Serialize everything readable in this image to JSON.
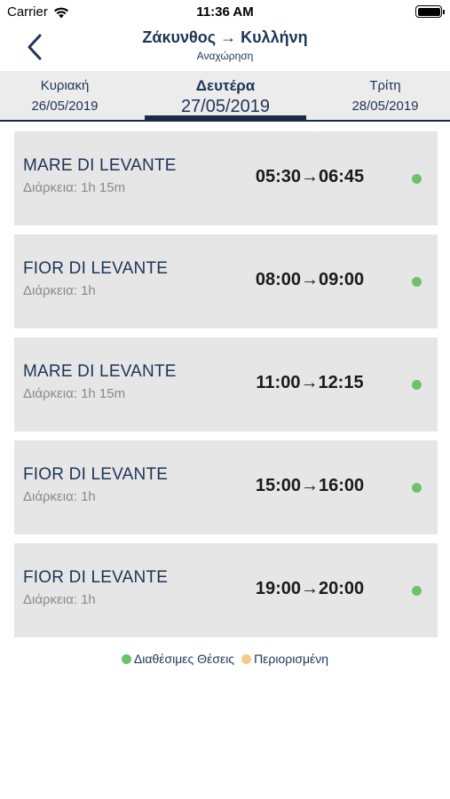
{
  "status_bar": {
    "carrier": "Carrier",
    "time": "11:36 AM"
  },
  "nav": {
    "title": "Ζάκυνθος → Κυλλήνη",
    "subtitle": "Αναχώρηση"
  },
  "dates": {
    "prev": {
      "day": "Κυριακή",
      "date": "26/05/2019"
    },
    "current": {
      "day": "Δευτέρα",
      "date": "27/05/2019"
    },
    "next": {
      "day": "Τρίτη",
      "date": "28/05/2019"
    }
  },
  "trips": [
    {
      "ship": "MARE DI LEVANTE",
      "duration": "Διάρκεια: 1h 15m",
      "time": "05:30→06:45",
      "status_color": "#6cc36a"
    },
    {
      "ship": "FIOR DI LEVANTE",
      "duration": "Διάρκεια: 1h",
      "time": "08:00→09:00",
      "status_color": "#6cc36a"
    },
    {
      "ship": "MARE DI LEVANTE",
      "duration": "Διάρκεια: 1h 15m",
      "time": "11:00→12:15",
      "status_color": "#6cc36a"
    },
    {
      "ship": "FIOR DI LEVANTE",
      "duration": "Διάρκεια: 1h",
      "time": "15:00→16:00",
      "status_color": "#6cc36a"
    },
    {
      "ship": "FIOR DI LEVANTE",
      "duration": "Διάρκεια: 1h",
      "time": "19:00→20:00",
      "status_color": "#6cc36a"
    }
  ],
  "legend": {
    "available": {
      "label": "Διαθέσιμες Θέσεις",
      "color": "#6cc36a"
    },
    "limited": {
      "label": "Περιορισμένη",
      "color": "#f7c98b"
    }
  },
  "icons": {
    "back": "chevron-left-icon",
    "wifi": "wifi-icon",
    "battery": "battery-icon"
  }
}
